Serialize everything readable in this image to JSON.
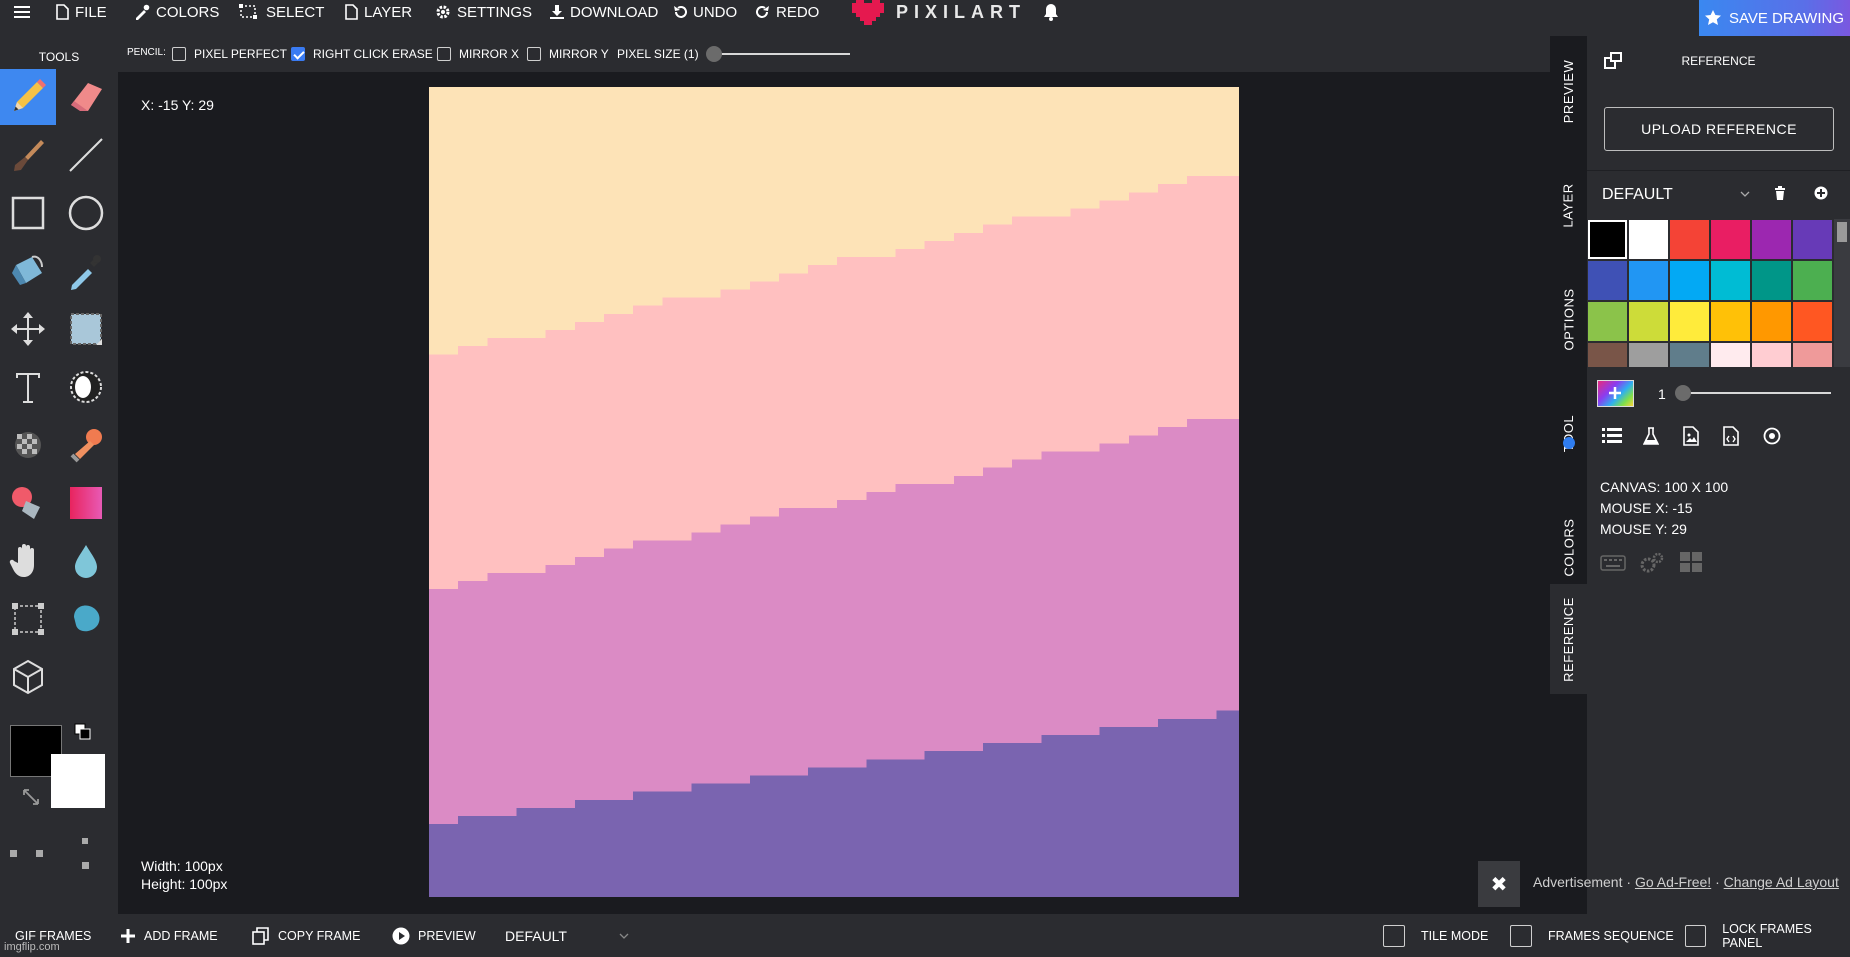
{
  "topbar": {
    "menu": [
      {
        "label": "FILE",
        "icon": "file-icon"
      },
      {
        "label": "COLORS",
        "icon": "eyedropper-icon"
      },
      {
        "label": "SELECT",
        "icon": "select-icon"
      },
      {
        "label": "LAYER",
        "icon": "layer-icon"
      },
      {
        "label": "SETTINGS",
        "icon": "gear-icon"
      },
      {
        "label": "DOWNLOAD",
        "icon": "download-icon"
      },
      {
        "label": "UNDO",
        "icon": "undo-icon"
      },
      {
        "label": "REDO",
        "icon": "redo-icon"
      }
    ],
    "brand": "PIXILART",
    "save_label": "SAVE DRAWING"
  },
  "options": {
    "tool_label": "PENCIL:",
    "checkboxes": [
      {
        "label": "PIXEL PERFECT",
        "checked": false
      },
      {
        "label": "RIGHT CLICK ERASE",
        "checked": true
      },
      {
        "label": "MIRROR X",
        "checked": false
      },
      {
        "label": "MIRROR Y",
        "checked": false
      }
    ],
    "pixel_size_label": "PIXEL SIZE (1)",
    "pixel_size_value": 1
  },
  "tools": {
    "title": "TOOLS",
    "active": "pencil-tool",
    "primary_color": "#000000",
    "secondary_color": "#ffffff"
  },
  "canvas": {
    "coords": "X: -15 Y: 29",
    "width_label": "Width: 100px",
    "height_label": "Height: 100px",
    "colors": [
      "#fde3b7",
      "#ffc0c0",
      "#db8bc5",
      "#7a64b0"
    ]
  },
  "vtabs": [
    "PREVIEW",
    "LAYER",
    "OPTIONS",
    "TOOL",
    "COLORS",
    "REFERENCE"
  ],
  "right_panel": {
    "title": "REFERENCE",
    "upload_label": "UPLOAD REFERENCE",
    "palette_name": "DEFAULT",
    "swatches": [
      "#000000",
      "#ffffff",
      "#f44336",
      "#e91e63",
      "#9c27b0",
      "#673ab7",
      "#3f51b5",
      "#2196f3",
      "#03a9f4",
      "#00bcd4",
      "#009688",
      "#4caf50",
      "#8bc34a",
      "#cddc39",
      "#ffeb3b",
      "#ffc107",
      "#ff9800",
      "#ff5722",
      "#795548",
      "#9e9e9e",
      "#607d8b",
      "#ffebee",
      "#ffcdd2",
      "#ef9a9a"
    ],
    "brush_value": "1",
    "canvas_info": "CANVAS: 100 X 100",
    "mouse_x": "MOUSE X: -15",
    "mouse_y": "MOUSE Y: 29"
  },
  "bottombar": {
    "gif_frames": "GIF FRAMES",
    "add_frame": "ADD FRAME",
    "copy_frame": "COPY FRAME",
    "preview": "PREVIEW",
    "frame_select": "DEFAULT",
    "tile_mode": "TILE MODE",
    "frames_sequence": "FRAMES SEQUENCE",
    "lock_frames_panel": "LOCK FRAMES PANEL"
  },
  "ad": {
    "text": "Advertisement · ",
    "go_ad_free": "Go Ad-Free!",
    "separator": " · ",
    "change_layout": "Change Ad Layout"
  },
  "watermark": "imgflip.com"
}
